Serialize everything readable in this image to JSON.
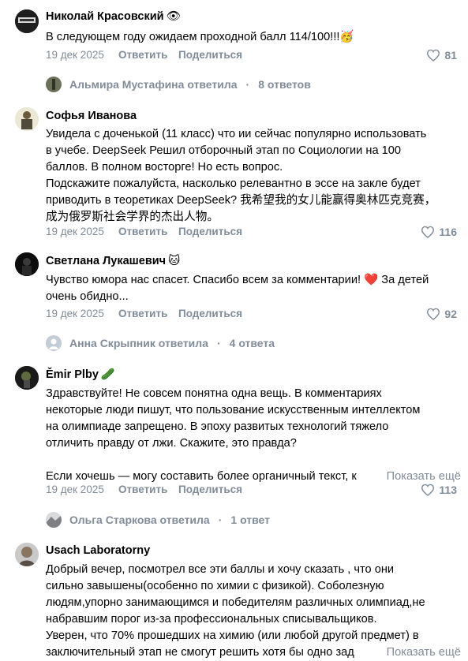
{
  "comments": [
    {
      "author": "Николай Красовский",
      "author_badge": "👁",
      "text": [
        "В следующем году ожидаем проходной балл 114/100!!!🥳"
      ],
      "date": "19 дек 2025",
      "reply_label": "Ответить",
      "share_label": "Поделиться",
      "likes": "81",
      "thread": {
        "name": "Альмира Мустафина ответила",
        "count": "8 ответов"
      }
    },
    {
      "author": "Софья Иванова",
      "text": [
        "Увидела с доченькой (11 класс) что ии сейчас популярно использовать",
        "в учебе. DeepSeek Решил отборочный этап по Социологии на 100",
        "баллов. В полном восторге! Но есть вопрос.",
        "Подскажите пожалуйста, насколько релевантно в эссе на закле будет",
        "приводить в теоретиках DeepSeek? 我希望我的女儿能赢得奥林匹克竞赛，",
        "成为俄罗斯社会学界的杰出人物。"
      ],
      "date": "19 дек 2025",
      "reply_label": "Ответить",
      "share_label": "Поделиться",
      "likes": "116"
    },
    {
      "author": "Светлана Лукашевич",
      "author_badge": "🐱",
      "text": [
        "Чувство юмора нас спасет. Спасибо всем за комментарии! ❤️ За детей",
        "очень обидно..."
      ],
      "date": "19 дек 2025",
      "reply_label": "Ответить",
      "share_label": "Поделиться",
      "likes": "92",
      "thread": {
        "name": "Анна Скрыпник ответила",
        "count": "4 ответа"
      }
    },
    {
      "author": "Ěmir Plby",
      "author_badge": "🥒",
      "text": [
        "Здравствуйте! Не совсем понятна одна вещь. В комментариях",
        "некоторые люди пишут, что пользование искусственным интеллектом",
        "на олимпиаде запрещено. В эпоху развитых технологий тяжело",
        "отличить правду от лжи. Скажите, это правда?",
        "",
        "Если хочешь — могу составить более органичный текст, к"
      ],
      "show_more": "Показать ещё",
      "date": "19 дек 2025",
      "reply_label": "Ответить",
      "share_label": "Поделиться",
      "likes": "113",
      "thread": {
        "name": "Ольга Старкова ответила",
        "count": "1 ответ"
      }
    },
    {
      "author": "Usach Laboratorny",
      "text": [
        "Добрый вечер, посмотрел все эти баллы и хочу сказать , что они",
        "сильно завышены(особенно по химии с физикой). Соболезную",
        "людям,упорно занимающимся и победителям различных олимпиад,не",
        "набравшим порог из-за профессиональных списывальщиков.",
        "Уверен, что 70% прошедших на химию (или любой другой предмет) в",
        "заключительный этап не смогут решить хотя бы одно зад"
      ],
      "show_more": "Показать ещё"
    }
  ],
  "colors": {
    "muted": "#818c99",
    "text": "#000000",
    "background": "#ffffff"
  },
  "icons": {
    "like": "heart-outline-icon"
  }
}
